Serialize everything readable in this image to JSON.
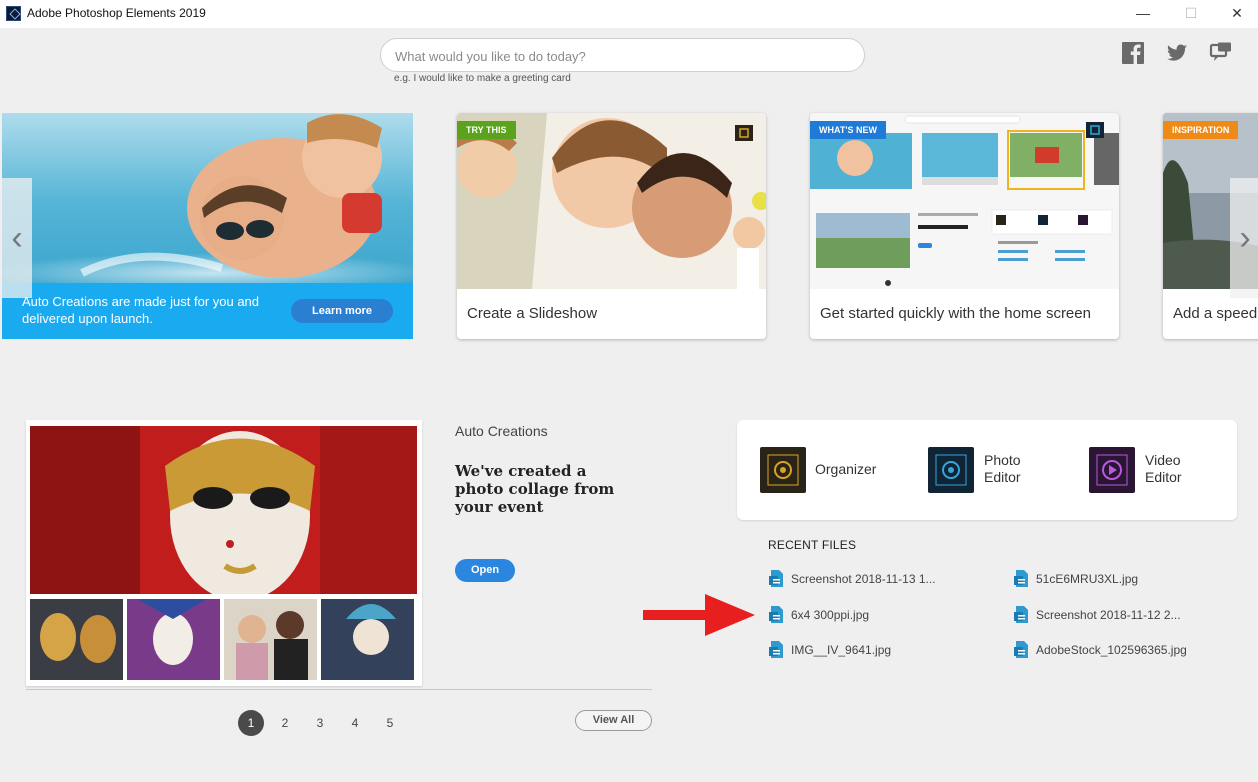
{
  "window": {
    "title": "Adobe Photoshop Elements 2019",
    "minimize": "—",
    "maximize": "☐",
    "close": "✕"
  },
  "search": {
    "placeholder": "What would you like to do today?",
    "hint": "e.g. I would like to make a greeting card"
  },
  "social": [
    "facebook-icon",
    "twitter-icon",
    "feedback-icon"
  ],
  "carousel": {
    "hero": {
      "text": "Auto Creations are made just for you and delivered upon launch.",
      "button": "Learn more"
    },
    "cards": [
      {
        "tag": "TRY THIS",
        "tag_color": "#5ba31c",
        "caption": "Create a Slideshow"
      },
      {
        "tag": "WHAT'S NEW",
        "tag_color": "#1f7ad8",
        "caption": "Get started quickly with the home screen"
      },
      {
        "tag": "INSPIRATION",
        "tag_color": "#f08a17",
        "caption": "Add a speed"
      }
    ],
    "prev": "‹",
    "next": "›"
  },
  "auto_creations": {
    "label": "Auto Creations",
    "title": "We've created a photo collage from your event",
    "open_button": "Open",
    "pages": [
      "1",
      "2",
      "3",
      "4",
      "5"
    ],
    "active_page": "1",
    "view_all": "View All"
  },
  "apps": [
    {
      "name": "Organizer",
      "color": "#2a2418",
      "accent": "#d8a326"
    },
    {
      "name": "Photo Editor",
      "color": "#102436",
      "accent": "#34a7d8"
    },
    {
      "name": "Video Editor",
      "color": "#2a1633",
      "accent": "#b75ae0"
    }
  ],
  "recent_files": {
    "title": "RECENT FILES",
    "items": [
      "Screenshot 2018-11-13 1...",
      "51cE6MRU3XL.jpg",
      "6x4 300ppi.jpg",
      "Screenshot 2018-11-12 2...",
      "IMG__IV_9641.jpg",
      "AdobeStock_102596365.jpg"
    ]
  },
  "colors": {
    "accent_blue": "#2b86e0",
    "hero_banner": "#1aaaf0",
    "arrow_red": "#e81f1f"
  }
}
